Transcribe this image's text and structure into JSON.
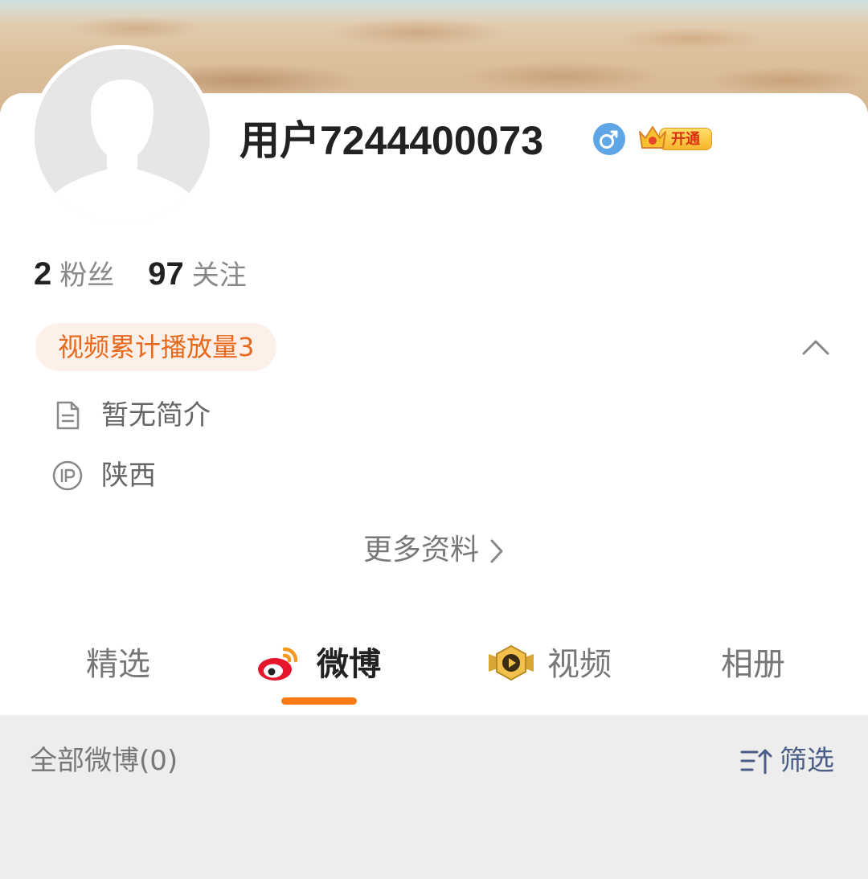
{
  "profile": {
    "username": "用户7244400073",
    "gender_icon": "male-symbol-icon",
    "vip_badge_text": "开通",
    "avatar_icon": "default-avatar-icon"
  },
  "stats": {
    "fans_count": "2",
    "fans_label": "粉丝",
    "following_count": "97",
    "following_label": "关注"
  },
  "video_tag": "视频累计播放量3",
  "info": {
    "bio": "暂无简介",
    "bio_icon": "document-icon",
    "ip_location": "陕西",
    "ip_icon": "ip-icon"
  },
  "more_info_label": "更多资料",
  "tabs": [
    {
      "label": "精选",
      "active": false
    },
    {
      "label": "微博",
      "active": true,
      "icon": "weibo-logo-icon"
    },
    {
      "label": "视频",
      "active": false,
      "icon": "video-badge-icon"
    },
    {
      "label": "相册",
      "active": false
    }
  ],
  "feed": {
    "title": "全部微博(0)",
    "filter_label": "筛选",
    "filter_icon": "sort-filter-icon"
  },
  "colors": {
    "accent_orange": "#ff7a14",
    "tag_text": "#e8691c",
    "tag_bg": "#fdf0e8",
    "filter_blue": "#4a5d86",
    "gender_blue": "#5fa6e6"
  }
}
